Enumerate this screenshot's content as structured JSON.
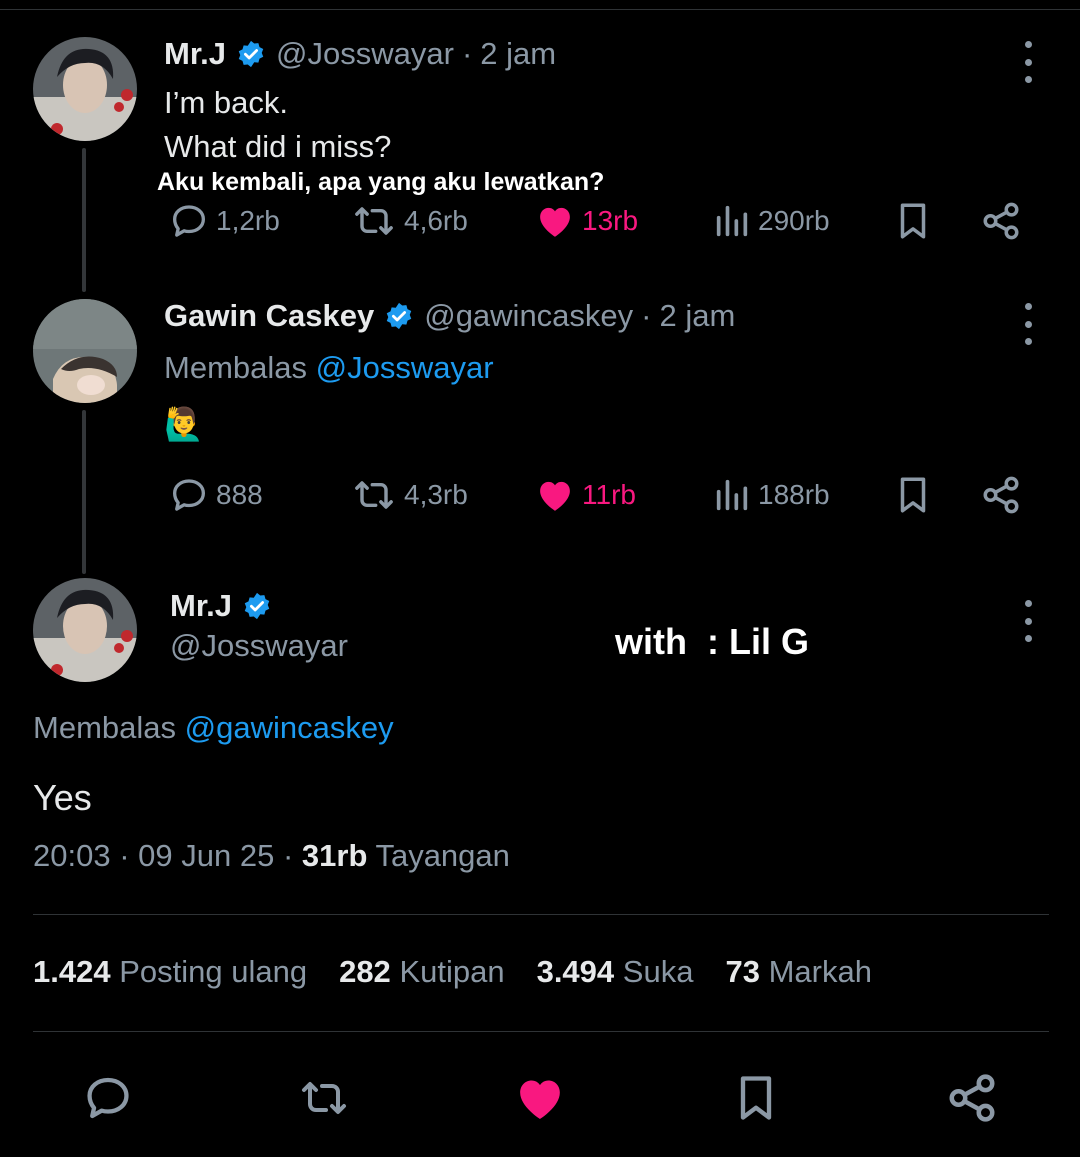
{
  "thread": [
    {
      "name": "Mr.J",
      "handle": "@Josswayar",
      "sep": "·",
      "time": "2 jam",
      "lines": [
        "I’m back.",
        "What did i miss?"
      ],
      "overlay_caption": "Aku kembali, apa yang aku lewatkan?",
      "stats": {
        "replies": "1,2rb",
        "reposts": "4,6rb",
        "likes": "13rb",
        "views": "290rb"
      }
    },
    {
      "name": "Gawin Caskey",
      "handle": "@gawincaskey",
      "sep": "·",
      "time": "2 jam",
      "replying_prefix": "Membalas",
      "replying_to": "@Josswayar",
      "body": "🙋‍♂️",
      "stats": {
        "replies": "888",
        "reposts": "4,3rb",
        "likes": "11rb",
        "views": "188rb"
      }
    }
  ],
  "main": {
    "name": "Mr.J",
    "handle": "@Josswayar",
    "overlay_caption": "with  : Lil G",
    "replying_prefix": "Membalas",
    "replying_to": "@gawincaskey",
    "text": "Yes",
    "time": "20:03",
    "sep": "·",
    "date": "09 Jun 25",
    "views": "31rb",
    "views_label": "Tayangan",
    "stats": [
      {
        "value": "1.424",
        "label": "Posting ulang"
      },
      {
        "value": "282",
        "label": "Kutipan"
      },
      {
        "value": "3.494",
        "label": "Suka"
      },
      {
        "value": "73",
        "label": "Markah"
      }
    ]
  },
  "colors": {
    "background": "#000000",
    "text": "#e7e9ea",
    "muted": "#8b98a5",
    "accent_blue": "#1d9bf0",
    "like_pink": "#f91880",
    "divider": "#2f3336"
  },
  "icons": [
    "verified-badge-icon",
    "more-options-icon",
    "reply-icon",
    "repost-icon",
    "like-icon",
    "views-icon",
    "bookmark-icon",
    "share-icon"
  ]
}
